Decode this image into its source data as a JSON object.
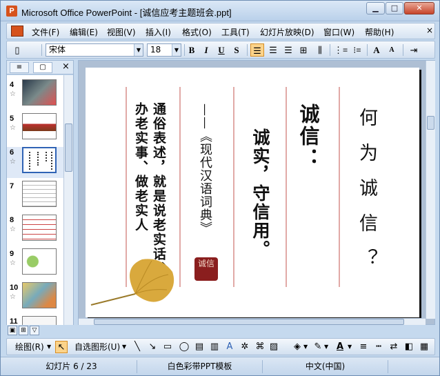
{
  "window": {
    "title": "Microsoft Office PowerPoint - [诚信应考主题班会.ppt]",
    "min_label": "▭",
    "max_label": "◻",
    "close_label": "✕"
  },
  "menu": {
    "items": [
      "文件(F)",
      "编辑(E)",
      "视图(V)",
      "插入(I)",
      "格式(O)",
      "工具(T)",
      "幻灯片放映(D)",
      "窗口(W)",
      "帮助(H)"
    ],
    "close_x": "×"
  },
  "toolbar": {
    "font_name": "宋体",
    "font_size": "18",
    "bold": "B",
    "italic": "I",
    "underline": "U",
    "shadow": "S",
    "grow": "A",
    "shrink": "A"
  },
  "pane": {
    "close": "×",
    "thumbnails": [
      {
        "num": "4",
        "star": "☆"
      },
      {
        "num": "5",
        "star": "☆"
      },
      {
        "num": "6",
        "star": "☆",
        "selected": true
      },
      {
        "num": "7",
        "star": ""
      },
      {
        "num": "8",
        "star": "☆"
      },
      {
        "num": "9",
        "star": "☆"
      },
      {
        "num": "10",
        "star": "☆"
      },
      {
        "num": "11",
        "star": "☆"
      }
    ]
  },
  "slide": {
    "col1": "何为诚信？",
    "col2": "诚信：",
    "col3": "诚实，守信用。",
    "col4_dash": "——",
    "col4": "《现代汉语词典》",
    "seal": "诚信",
    "col5": "通俗表述，就是说老实话、",
    "col6": "办老实事、做老实人"
  },
  "drawbar": {
    "draw_label": "绘图(R)",
    "autoshape_label": "自选图形(U)"
  },
  "status": {
    "slide_pos": "幻灯片 6 / 23",
    "template": "白色彩带PPT模板",
    "language": "中文(中国)"
  },
  "colors": {
    "accent_red_line": "#e1a9a6",
    "selection_blue": "#2f63b5",
    "seal_red": "#8a1e1e",
    "ginkgo_yellow": "#d9a93d"
  }
}
